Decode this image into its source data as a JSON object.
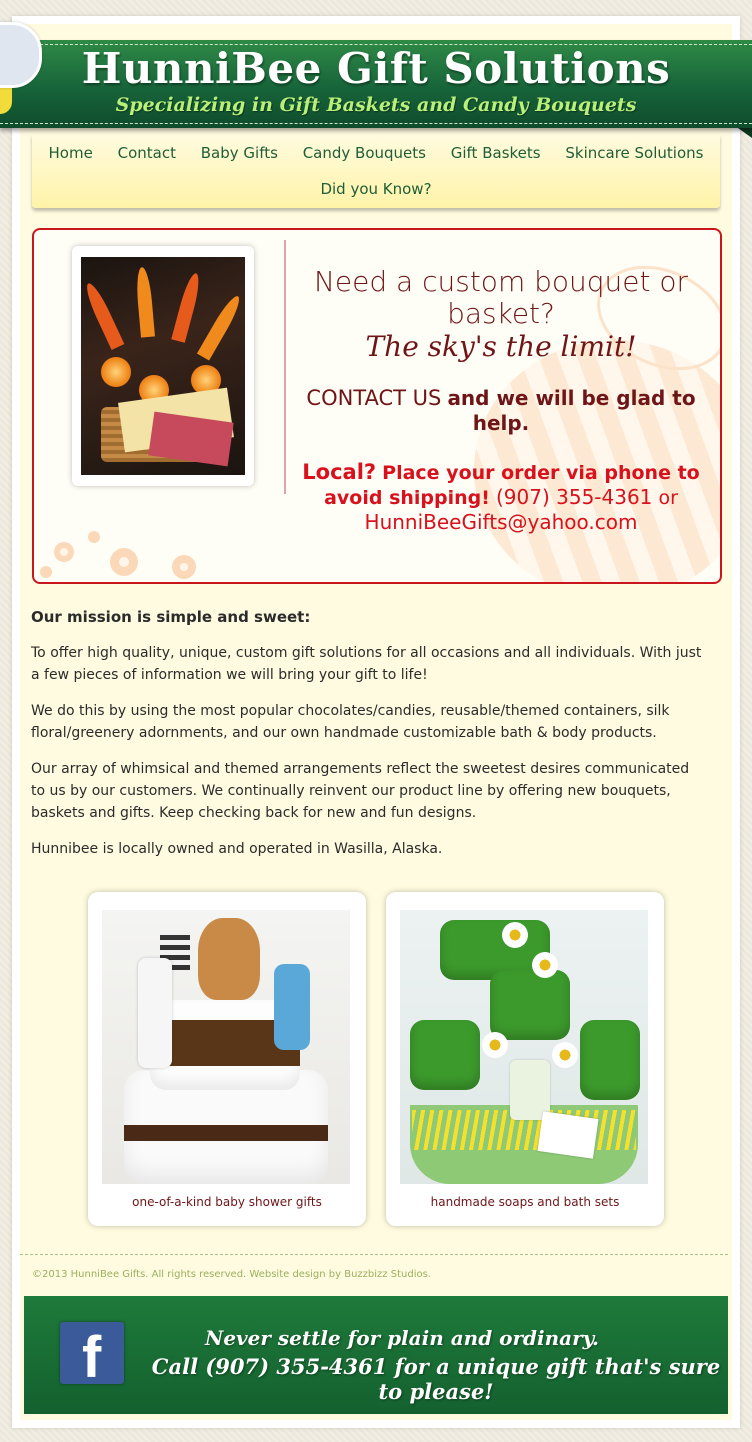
{
  "header": {
    "title": "HunniBee Gift Solutions",
    "tagline": "Specializing in Gift Baskets and Candy Bouquets"
  },
  "nav": {
    "items": [
      "Home",
      "Contact",
      "Baby Gifts",
      "Candy Bouquets",
      "Gift Baskets",
      "Skincare Solutions",
      "Did you Know?"
    ]
  },
  "promo": {
    "line1": "Need a custom bouquet or basket?",
    "line2": "The sky's the limit!",
    "contact_lead": "CONTACT US",
    "contact_rest": "and we will be glad to help.",
    "local_lead": "Local?",
    "local_rest": "Place your order via phone to avoid shipping!",
    "phone": "(907) 355-4361",
    "or": "or",
    "email": "HunniBeeGifts@yahoo.com"
  },
  "mission": {
    "heading": "Our mission is simple and sweet:",
    "p1": "To offer high quality, unique, custom gift solutions for all occasions and all individuals. With just a few pieces of information we will bring your gift to life!",
    "p2": "We do this by using the most popular chocolates/candies, reusable/themed containers, silk floral/greenery adornments, and our own handmade customizable bath & body products.",
    "p3": "Our array of whimsical and themed arrangements reflect the sweetest desires communicated to us by our customers. We continually reinvent our product line by offering new bouquets, baskets and gifts. Keep checking back for new and fun designs.",
    "p4": "Hunnibee is locally owned and operated in Wasilla, Alaska."
  },
  "gallery": [
    {
      "caption": "one-of-a-kind baby shower gifts"
    },
    {
      "caption": "handmade soaps and bath sets"
    }
  ],
  "footer": {
    "copyright": "©2013 HunniBee Gifts. All rights reserved. Website design by Buzzbizz Studios.",
    "slogan1": "Never settle for plain and ordinary.",
    "slogan2": "Call (907) 355-4361 for a unique gift that's sure to please!",
    "facebook_glyph": "f"
  },
  "colors": {
    "brand_green": "#17643a",
    "tagline_green": "#b9f07a",
    "accent_red": "#d8111c",
    "maroon": "#6e1518",
    "background_cream": "#fffbe0",
    "facebook_blue": "#3b5a99"
  }
}
